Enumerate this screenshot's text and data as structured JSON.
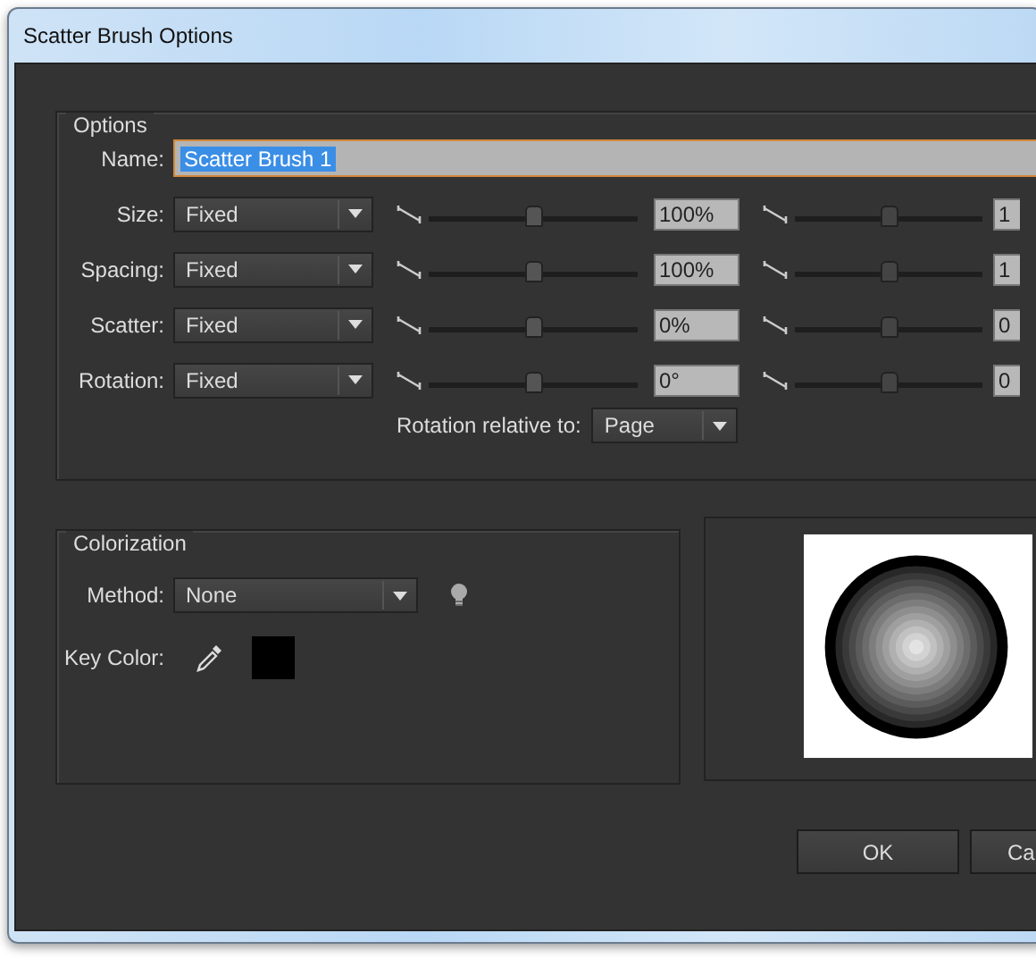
{
  "window": {
    "title": "Scatter Brush Options"
  },
  "options": {
    "heading": "Options",
    "name_label": "Name:",
    "name_value": "Scatter Brush 1",
    "name_text_selected": true,
    "rows": [
      {
        "label": "Size:",
        "method": "Fixed",
        "slider": {
          "level": 0.5
        },
        "value": "100%",
        "variation_slider": {
          "level": 0.5
        },
        "variation_value": "1"
      },
      {
        "label": "Spacing:",
        "method": "Fixed",
        "slider": {
          "level": 0.5
        },
        "value": "100%",
        "variation_slider": {
          "level": 0.5
        },
        "variation_value": "1"
      },
      {
        "label": "Scatter:",
        "method": "Fixed",
        "slider": {
          "level": 0.5
        },
        "value": "0%",
        "variation_slider": {
          "level": 0.5
        },
        "variation_value": "0"
      },
      {
        "label": "Rotation:",
        "method": "Fixed",
        "slider": {
          "level": 0.5
        },
        "value": "0°",
        "variation_slider": {
          "level": 0.5
        },
        "variation_value": "0"
      }
    ],
    "rotation_relative_label": "Rotation relative to:",
    "rotation_relative_value": "Page"
  },
  "colorization": {
    "heading": "Colorization",
    "method_label": "Method:",
    "method_value": "None",
    "key_color_label": "Key Color:"
  },
  "buttons": [
    "OK",
    "Ca"
  ]
}
